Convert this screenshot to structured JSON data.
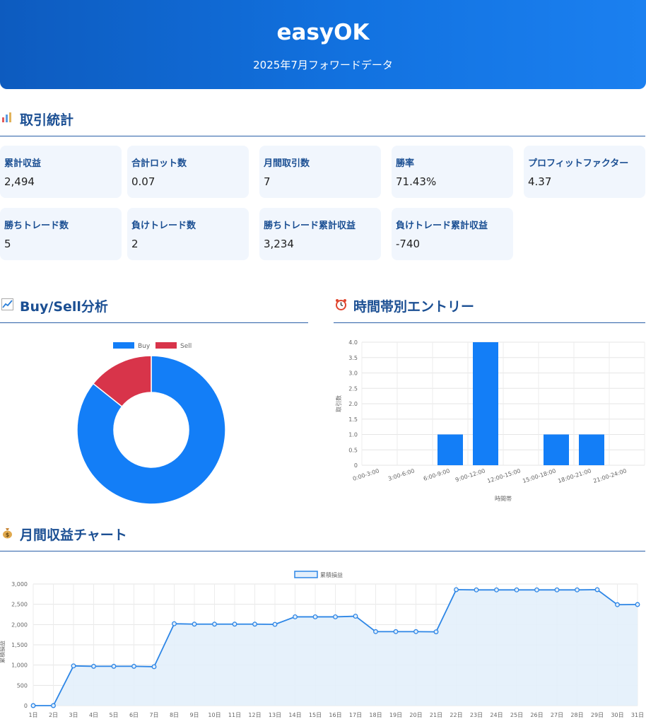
{
  "header": {
    "title": "easyOK",
    "subtitle": "2025年7月フォワードデータ"
  },
  "sections": {
    "stats": {
      "title": "取引統計",
      "icon": "bar-chart-icon"
    },
    "buysell": {
      "title": "Buy/Sell分析",
      "icon": "chart-increasing-icon"
    },
    "hourly": {
      "title": "時間帯別エントリー",
      "icon": "alarm-clock-icon"
    },
    "monthly": {
      "title": "月間収益チャート",
      "icon": "money-bag-icon"
    }
  },
  "stats": [
    {
      "label": "累計収益",
      "value": "2,494"
    },
    {
      "label": "合計ロット数",
      "value": "0.07"
    },
    {
      "label": "月間取引数",
      "value": "7"
    },
    {
      "label": "勝率",
      "value": "71.43%"
    },
    {
      "label": "プロフィットファクター",
      "value": "4.37"
    },
    {
      "label": "勝ちトレード数",
      "value": "5"
    },
    {
      "label": "負けトレード数",
      "value": "2"
    },
    {
      "label": "勝ちトレード累計収益",
      "value": "3,234"
    },
    {
      "label": "負けトレード累計収益",
      "value": "-740"
    }
  ],
  "colors": {
    "buy": "#137ef7",
    "sell": "#d8344a",
    "line": "#2d86e6",
    "fill": "#e3effb"
  },
  "chart_data": [
    {
      "type": "pie",
      "variant": "doughnut",
      "legend_position": "top",
      "categories": [
        "Buy",
        "Sell"
      ],
      "values": [
        6,
        1
      ]
    },
    {
      "type": "bar",
      "categories": [
        "0:00-3:00",
        "3:00-6:00",
        "6:00-9:00",
        "9:00-12:00",
        "12:00-15:00",
        "15:00-18:00",
        "18:00-21:00",
        "21:00-24:00"
      ],
      "values": [
        0,
        0,
        1,
        4,
        0,
        1,
        1,
        0
      ],
      "xlabel": "時間帯",
      "ylabel": "取引数",
      "ylim": [
        0,
        4
      ],
      "yticks": [
        "0",
        "0.5",
        "1.0",
        "1.5",
        "2.0",
        "2.5",
        "3.0",
        "3.5",
        "4.0"
      ],
      "grid": true
    },
    {
      "type": "area",
      "legend_position": "top",
      "series": [
        {
          "name": "累積損益",
          "values": [
            0,
            0,
            980,
            970,
            970,
            970,
            960,
            2020,
            2010,
            2010,
            2010,
            2010,
            2005,
            2190,
            2190,
            2190,
            2205,
            1825,
            1825,
            1825,
            1820,
            2860,
            2855,
            2855,
            2855,
            2855,
            2855,
            2855,
            2860,
            2490,
            2494
          ]
        }
      ],
      "categories": [
        "1日",
        "2日",
        "3日",
        "4日",
        "5日",
        "6日",
        "7日",
        "8日",
        "9日",
        "10日",
        "11日",
        "12日",
        "13日",
        "14日",
        "15日",
        "16日",
        "17日",
        "18日",
        "19日",
        "20日",
        "21日",
        "22日",
        "23日",
        "24日",
        "25日",
        "26日",
        "27日",
        "28日",
        "29日",
        "30日",
        "31日"
      ],
      "ylabel": "累積損益",
      "ylim": [
        0,
        3000
      ],
      "yticks": [
        "0",
        "500",
        "1,000",
        "1,500",
        "2,000",
        "2,500",
        "3,000"
      ],
      "grid": true
    }
  ]
}
